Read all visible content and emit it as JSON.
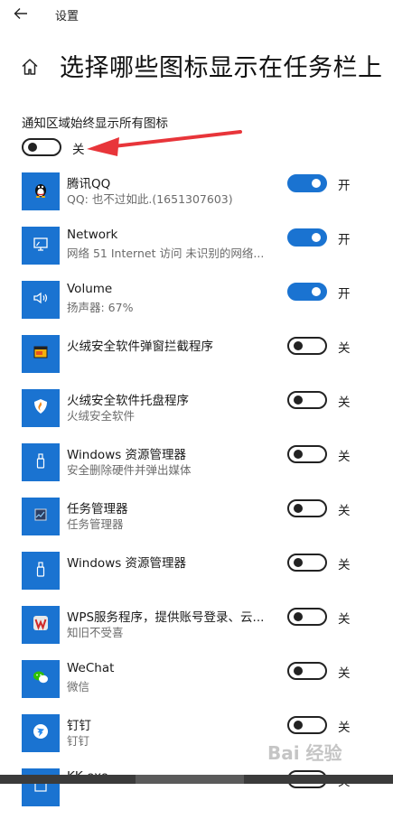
{
  "window": {
    "title": "设置",
    "back_icon": "back-arrow-icon",
    "home_icon": "home-icon"
  },
  "page": {
    "title": "选择哪些图标显示在任务栏上"
  },
  "always_show": {
    "label": "通知区域始终显示所有图标",
    "state": "关",
    "on": false
  },
  "colors": {
    "accent": "#1a73d1",
    "arrow": "#e8353a"
  },
  "items": [
    {
      "name": "腾讯QQ",
      "sub": "QQ: 也不过如此.(1651307603)",
      "state": "开",
      "on": true,
      "icon": "qq-penguin-icon"
    },
    {
      "name": "Network",
      "sub": "网络 51 Internet 访问  未识别的网络...",
      "state": "开",
      "on": true,
      "icon": "network-monitor-icon"
    },
    {
      "name": "Volume",
      "sub": "扬声器: 67%",
      "state": "开",
      "on": true,
      "icon": "speaker-icon"
    },
    {
      "name": "火绒安全软件弹窗拦截程序",
      "sub": "",
      "state": "关",
      "on": false,
      "icon": "popup-blocker-icon"
    },
    {
      "name": "火绒安全软件托盘程序",
      "sub": "火绒安全软件",
      "state": "关",
      "on": false,
      "icon": "shield-icon"
    },
    {
      "name": "Windows 资源管理器",
      "sub": "安全删除硬件并弹出媒体",
      "state": "关",
      "on": false,
      "icon": "usb-drive-icon"
    },
    {
      "name": "任务管理器",
      "sub": "任务管理器",
      "state": "关",
      "on": false,
      "icon": "task-manager-icon"
    },
    {
      "name": "Windows 资源管理器",
      "sub": "",
      "state": "关",
      "on": false,
      "icon": "usb-drive-icon"
    },
    {
      "name": "WPS服务程序，提供账号登录、云...",
      "sub": "知旧不受喜",
      "state": "关",
      "on": false,
      "icon": "wps-icon"
    },
    {
      "name": "WeChat",
      "sub": "微信",
      "state": "关",
      "on": false,
      "icon": "wechat-icon"
    },
    {
      "name": "钉钉",
      "sub": "钉钉",
      "state": "关",
      "on": false,
      "icon": "dingtalk-icon"
    },
    {
      "name": "KK.exe",
      "sub": "",
      "state": "关",
      "on": false,
      "icon": "app-icon"
    }
  ],
  "watermark": "Bai 经验"
}
